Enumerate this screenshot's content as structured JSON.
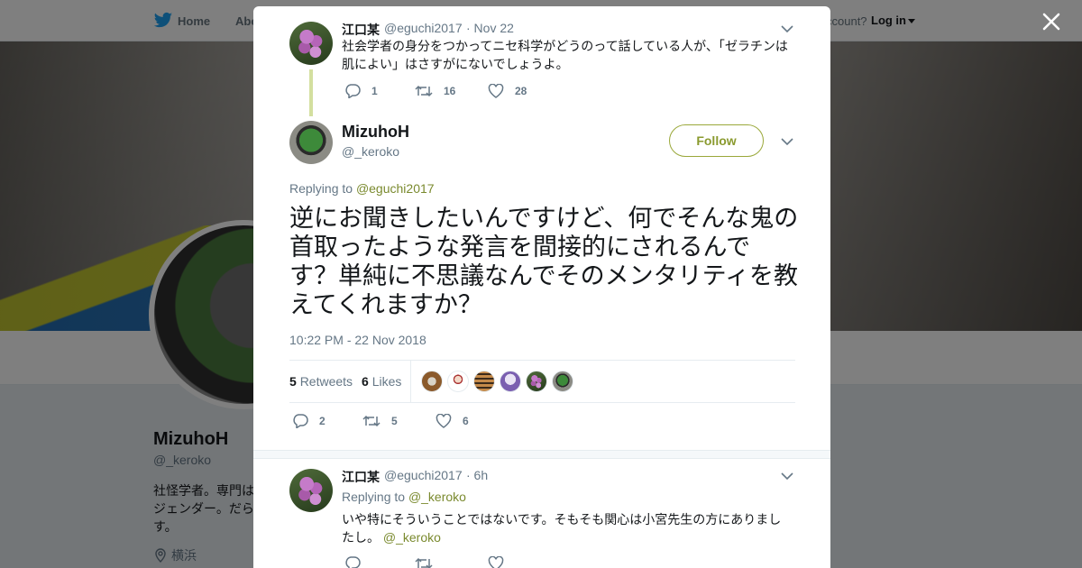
{
  "topbar": {
    "home_label": "Home",
    "about_label": "Abo",
    "account_text": "ccount?",
    "login_label": "Log in"
  },
  "profile": {
    "name": "MizuhoH",
    "handle": "@_keroko",
    "bio": "社怪学者。専門は\nジェンダー。だら\nす。",
    "location": "横浜"
  },
  "modal": {
    "parent_tweet": {
      "name": "江口某",
      "handle": "@eguchi2017",
      "time": "· Nov 22",
      "text": "社会学者の身分をつかってニセ科学がどうのって話している人が、「ゼラチンは肌によい」はさすがにないでしょうよ。",
      "replies": "1",
      "retweets": "16",
      "likes": "28"
    },
    "main_tweet": {
      "name": "MizuhoH",
      "handle": "@_keroko",
      "follow_label": "Follow",
      "replying_prefix": "Replying to",
      "replying_to": "@eguchi2017",
      "text": "逆にお聞きしたいんですけど、何でそんな鬼の首取ったような発言を間接的にされるんです？単純に不思議なんでそのメンタリティを教えてくれますか？",
      "timestamp": "10:22 PM - 22 Nov 2018",
      "retweets_count": "5",
      "retweets_label": "Retweets",
      "likes_count": "6",
      "likes_label": "Likes",
      "replies": "2",
      "retweets": "5",
      "likes": "6"
    },
    "reply_tweet": {
      "name": "江口某",
      "handle": "@eguchi2017",
      "time": "· 6h",
      "replying_prefix": "Replying to",
      "replying_to": "@_keroko",
      "text": "いや特にそういうことではないです。そもそも関心は小宮先生の方にありましたし。",
      "mention": "@_keroko"
    }
  },
  "colors": {
    "accent": "#8a9a2e",
    "thread_line": "#d3df9f",
    "muted": "#657786"
  }
}
